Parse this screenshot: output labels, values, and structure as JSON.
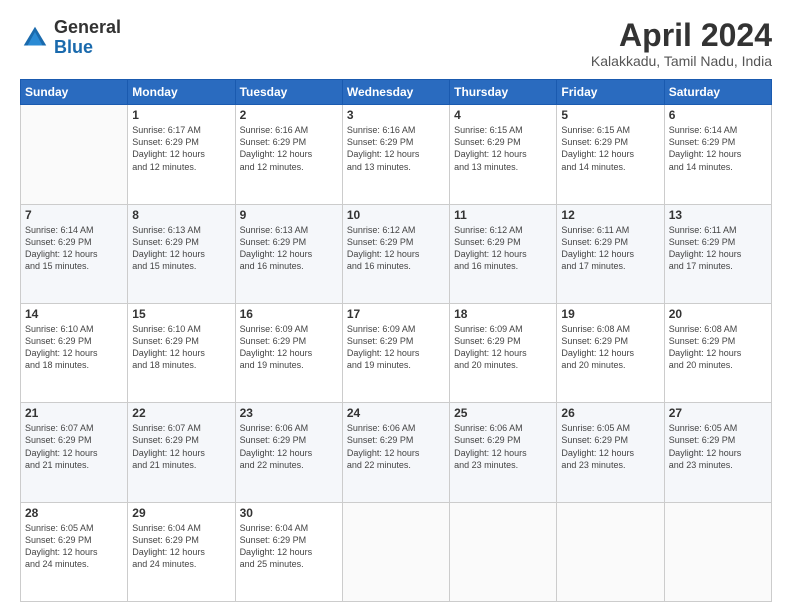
{
  "logo": {
    "general": "General",
    "blue": "Blue"
  },
  "header": {
    "month": "April 2024",
    "location": "Kalakkadu, Tamil Nadu, India"
  },
  "weekdays": [
    "Sunday",
    "Monday",
    "Tuesday",
    "Wednesday",
    "Thursday",
    "Friday",
    "Saturday"
  ],
  "weeks": [
    [
      {
        "day": "",
        "info": ""
      },
      {
        "day": "1",
        "info": "Sunrise: 6:17 AM\nSunset: 6:29 PM\nDaylight: 12 hours\nand 12 minutes."
      },
      {
        "day": "2",
        "info": "Sunrise: 6:16 AM\nSunset: 6:29 PM\nDaylight: 12 hours\nand 12 minutes."
      },
      {
        "day": "3",
        "info": "Sunrise: 6:16 AM\nSunset: 6:29 PM\nDaylight: 12 hours\nand 13 minutes."
      },
      {
        "day": "4",
        "info": "Sunrise: 6:15 AM\nSunset: 6:29 PM\nDaylight: 12 hours\nand 13 minutes."
      },
      {
        "day": "5",
        "info": "Sunrise: 6:15 AM\nSunset: 6:29 PM\nDaylight: 12 hours\nand 14 minutes."
      },
      {
        "day": "6",
        "info": "Sunrise: 6:14 AM\nSunset: 6:29 PM\nDaylight: 12 hours\nand 14 minutes."
      }
    ],
    [
      {
        "day": "7",
        "info": "Sunrise: 6:14 AM\nSunset: 6:29 PM\nDaylight: 12 hours\nand 15 minutes."
      },
      {
        "day": "8",
        "info": "Sunrise: 6:13 AM\nSunset: 6:29 PM\nDaylight: 12 hours\nand 15 minutes."
      },
      {
        "day": "9",
        "info": "Sunrise: 6:13 AM\nSunset: 6:29 PM\nDaylight: 12 hours\nand 16 minutes."
      },
      {
        "day": "10",
        "info": "Sunrise: 6:12 AM\nSunset: 6:29 PM\nDaylight: 12 hours\nand 16 minutes."
      },
      {
        "day": "11",
        "info": "Sunrise: 6:12 AM\nSunset: 6:29 PM\nDaylight: 12 hours\nand 16 minutes."
      },
      {
        "day": "12",
        "info": "Sunrise: 6:11 AM\nSunset: 6:29 PM\nDaylight: 12 hours\nand 17 minutes."
      },
      {
        "day": "13",
        "info": "Sunrise: 6:11 AM\nSunset: 6:29 PM\nDaylight: 12 hours\nand 17 minutes."
      }
    ],
    [
      {
        "day": "14",
        "info": "Sunrise: 6:10 AM\nSunset: 6:29 PM\nDaylight: 12 hours\nand 18 minutes."
      },
      {
        "day": "15",
        "info": "Sunrise: 6:10 AM\nSunset: 6:29 PM\nDaylight: 12 hours\nand 18 minutes."
      },
      {
        "day": "16",
        "info": "Sunrise: 6:09 AM\nSunset: 6:29 PM\nDaylight: 12 hours\nand 19 minutes."
      },
      {
        "day": "17",
        "info": "Sunrise: 6:09 AM\nSunset: 6:29 PM\nDaylight: 12 hours\nand 19 minutes."
      },
      {
        "day": "18",
        "info": "Sunrise: 6:09 AM\nSunset: 6:29 PM\nDaylight: 12 hours\nand 20 minutes."
      },
      {
        "day": "19",
        "info": "Sunrise: 6:08 AM\nSunset: 6:29 PM\nDaylight: 12 hours\nand 20 minutes."
      },
      {
        "day": "20",
        "info": "Sunrise: 6:08 AM\nSunset: 6:29 PM\nDaylight: 12 hours\nand 20 minutes."
      }
    ],
    [
      {
        "day": "21",
        "info": "Sunrise: 6:07 AM\nSunset: 6:29 PM\nDaylight: 12 hours\nand 21 minutes."
      },
      {
        "day": "22",
        "info": "Sunrise: 6:07 AM\nSunset: 6:29 PM\nDaylight: 12 hours\nand 21 minutes."
      },
      {
        "day": "23",
        "info": "Sunrise: 6:06 AM\nSunset: 6:29 PM\nDaylight: 12 hours\nand 22 minutes."
      },
      {
        "day": "24",
        "info": "Sunrise: 6:06 AM\nSunset: 6:29 PM\nDaylight: 12 hours\nand 22 minutes."
      },
      {
        "day": "25",
        "info": "Sunrise: 6:06 AM\nSunset: 6:29 PM\nDaylight: 12 hours\nand 23 minutes."
      },
      {
        "day": "26",
        "info": "Sunrise: 6:05 AM\nSunset: 6:29 PM\nDaylight: 12 hours\nand 23 minutes."
      },
      {
        "day": "27",
        "info": "Sunrise: 6:05 AM\nSunset: 6:29 PM\nDaylight: 12 hours\nand 23 minutes."
      }
    ],
    [
      {
        "day": "28",
        "info": "Sunrise: 6:05 AM\nSunset: 6:29 PM\nDaylight: 12 hours\nand 24 minutes."
      },
      {
        "day": "29",
        "info": "Sunrise: 6:04 AM\nSunset: 6:29 PM\nDaylight: 12 hours\nand 24 minutes."
      },
      {
        "day": "30",
        "info": "Sunrise: 6:04 AM\nSunset: 6:29 PM\nDaylight: 12 hours\nand 25 minutes."
      },
      {
        "day": "",
        "info": ""
      },
      {
        "day": "",
        "info": ""
      },
      {
        "day": "",
        "info": ""
      },
      {
        "day": "",
        "info": ""
      }
    ]
  ]
}
